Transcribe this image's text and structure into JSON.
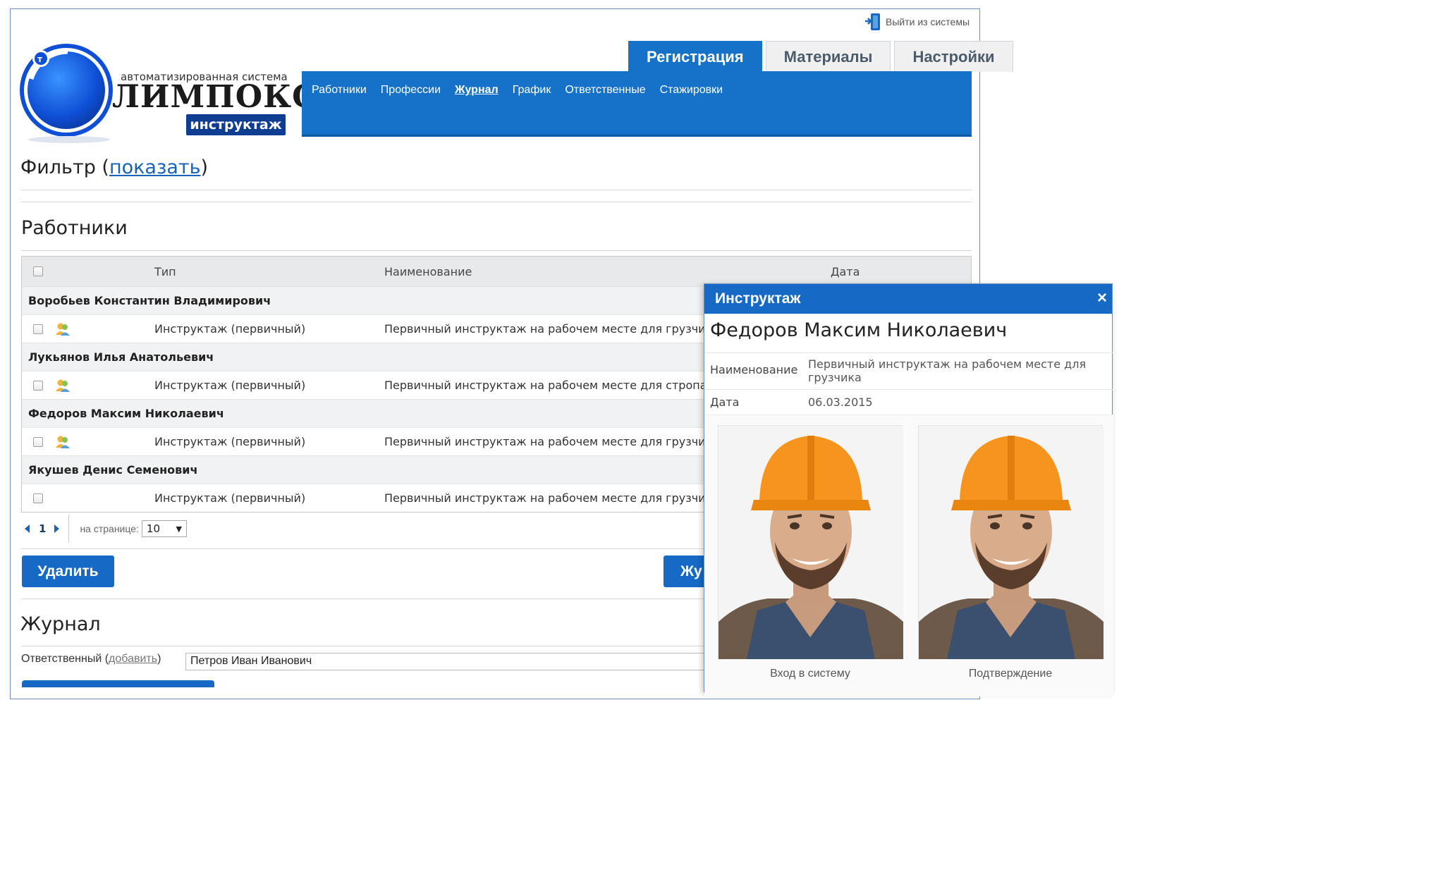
{
  "header": {
    "logout_label": "Выйти из системы",
    "logo": {
      "caption": "автоматизированная система",
      "brand": "ЛИМПОКС",
      "product": "инструктаж"
    }
  },
  "tabs": [
    {
      "label": "Регистрация",
      "active": true
    },
    {
      "label": "Материалы",
      "active": false
    },
    {
      "label": "Настройки",
      "active": false
    }
  ],
  "subnav": [
    {
      "label": "Работники",
      "active": false
    },
    {
      "label": "Профессии",
      "active": false
    },
    {
      "label": "Журнал",
      "active": true
    },
    {
      "label": "График",
      "active": false
    },
    {
      "label": "Ответственные",
      "active": false
    },
    {
      "label": "Стажировки",
      "active": false
    }
  ],
  "filter": {
    "label": "Фильтр (",
    "link": "показать",
    "close": ")"
  },
  "workers": {
    "title": "Работники",
    "columns": {
      "type": "Тип",
      "name": "Наименование",
      "date": "Дата"
    },
    "groups": [
      {
        "name": "Воробьев Константин Владимирович",
        "row": {
          "type": "Инструктаж (первичный)",
          "name": "Первичный инструктаж на рабочем месте для грузчика",
          "has_photo": true
        }
      },
      {
        "name": "Лукьянов Илья Анатольевич",
        "row": {
          "type": "Инструктаж (первичный)",
          "name": "Первичный инструктаж на рабочем месте для стропальщ",
          "has_photo": true
        }
      },
      {
        "name": "Федоров Максим Николаевич",
        "row": {
          "type": "Инструктаж (первичный)",
          "name": "Первичный инструктаж на рабочем месте для грузчика",
          "has_photo": true
        }
      },
      {
        "name": "Якушев Денис Семенович",
        "row": {
          "type": "Инструктаж (первичный)",
          "name": "Первичный инструктаж на рабочем месте для грузчика",
          "has_photo": false
        }
      }
    ],
    "pager": {
      "page": "1",
      "per_page_label": "на странице:",
      "per_page": "10"
    },
    "delete_button": "Удалить",
    "journal_button": "Жу"
  },
  "journal": {
    "title": "Журнал",
    "responsible_label": "Ответственный (",
    "responsible_link": "добавить",
    "responsible_close": ")",
    "responsible_value": "Петров Иван Иванович"
  },
  "dialog": {
    "title": "Инструктаж",
    "close": "×",
    "person": "Федоров Максим Николаевич",
    "fields": [
      {
        "label": "Наименование",
        "value": "Первичный инструктаж на рабочем месте для грузчика"
      },
      {
        "label": "Дата",
        "value": "06.03.2015"
      }
    ],
    "photos": [
      {
        "caption": "Вход в систему"
      },
      {
        "caption": "Подтверждение"
      }
    ]
  },
  "colors": {
    "accent": "#1769c6",
    "link": "#1a63b4",
    "helmet": "#f5951f"
  }
}
